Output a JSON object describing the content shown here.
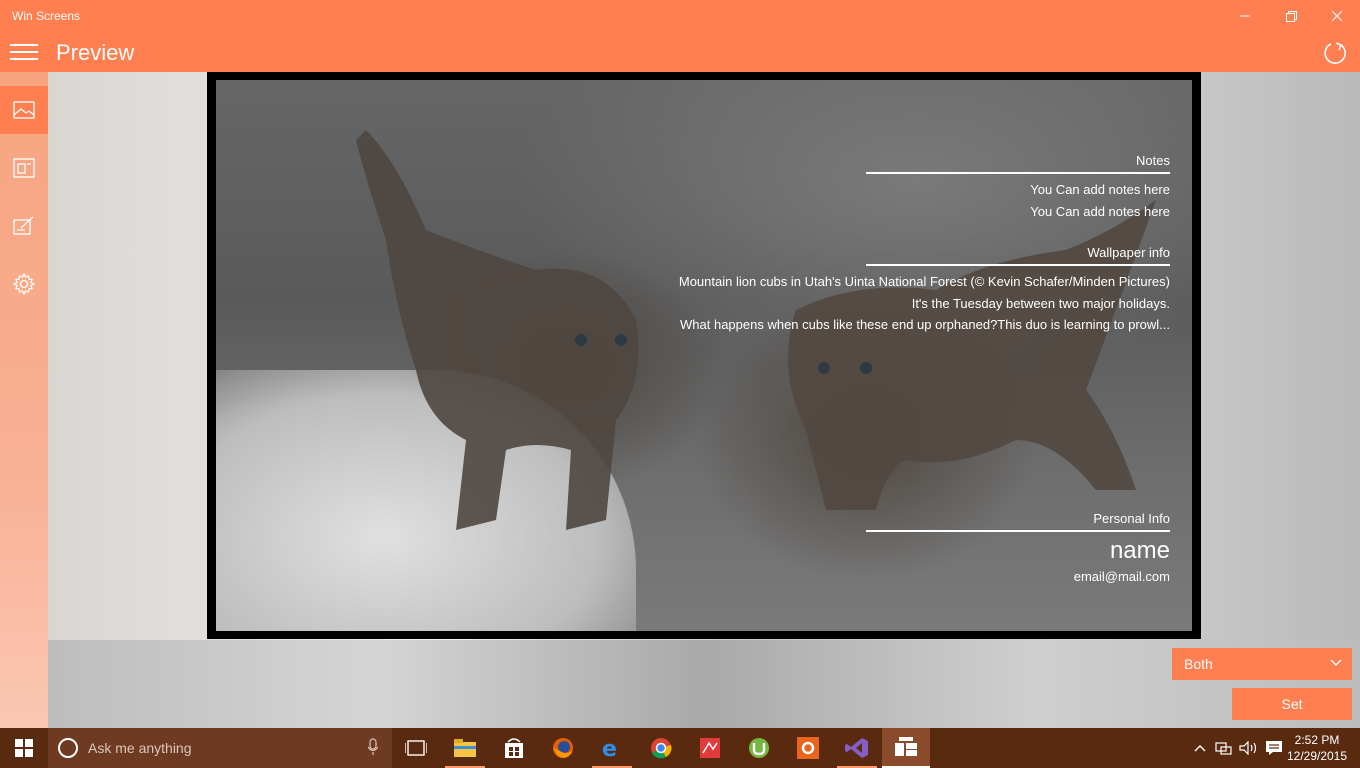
{
  "window": {
    "title": "Win Screens"
  },
  "appbar": {
    "page_title": "Preview"
  },
  "preview": {
    "notes": {
      "heading": "Notes",
      "lines": [
        "You Can add notes here",
        "You Can add notes here"
      ]
    },
    "wallpaper_info": {
      "heading": "Wallpaper info",
      "lines": [
        "Mountain lion cubs in Utah's Uinta National Forest (© Kevin Schafer/Minden Pictures)",
        "It's the Tuesday between two major holidays.",
        "What happens when cubs like these end up orphaned?This duo is learning to prowl..."
      ]
    },
    "personal_info": {
      "heading": "Personal Info",
      "name": "name",
      "email": "email@mail.com"
    }
  },
  "controls": {
    "target_select": {
      "value": "Both"
    },
    "set_label": "Set"
  },
  "taskbar": {
    "search_placeholder": "Ask me anything",
    "time": "2:52 PM",
    "date": "12/29/2015"
  },
  "colors": {
    "accent": "#ff7f50",
    "taskbar": "#5a2a10"
  }
}
